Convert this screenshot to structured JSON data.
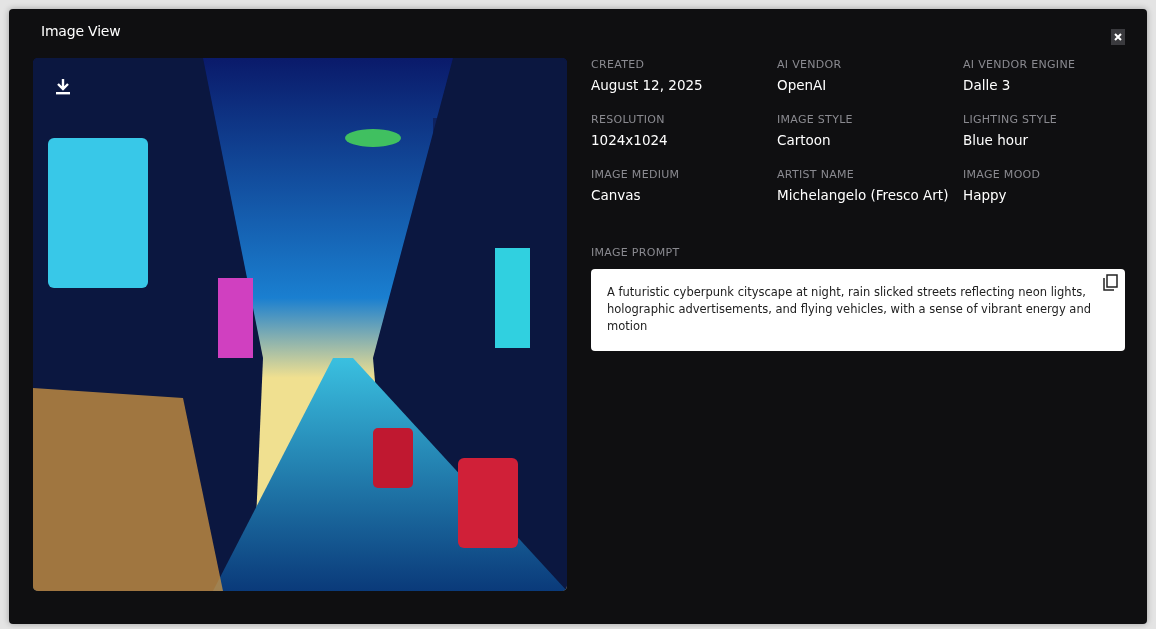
{
  "dialog": {
    "title": "Image View"
  },
  "details": [
    {
      "label": "CREATED",
      "value": "August 12, 2025"
    },
    {
      "label": "AI VENDOR",
      "value": "OpenAI"
    },
    {
      "label": "AI VENDOR ENGINE",
      "value": "Dalle 3"
    },
    {
      "label": "RESOLUTION",
      "value": "1024x1024"
    },
    {
      "label": "IMAGE STYLE",
      "value": "Cartoon"
    },
    {
      "label": "LIGHTING STYLE",
      "value": "Blue hour"
    },
    {
      "label": "IMAGE MEDIUM",
      "value": "Canvas"
    },
    {
      "label": "ARTIST NAME",
      "value": "Michelangelo (Fresco Art)"
    },
    {
      "label": "IMAGE MOOD",
      "value": "Happy"
    }
  ],
  "prompt": {
    "label": "IMAGE PROMPT",
    "text": "A futuristic cyberpunk cityscape at night, rain slicked streets reflecting neon lights, holographic advertisements, and flying vehicles, with a sense of vibrant energy and motion"
  }
}
